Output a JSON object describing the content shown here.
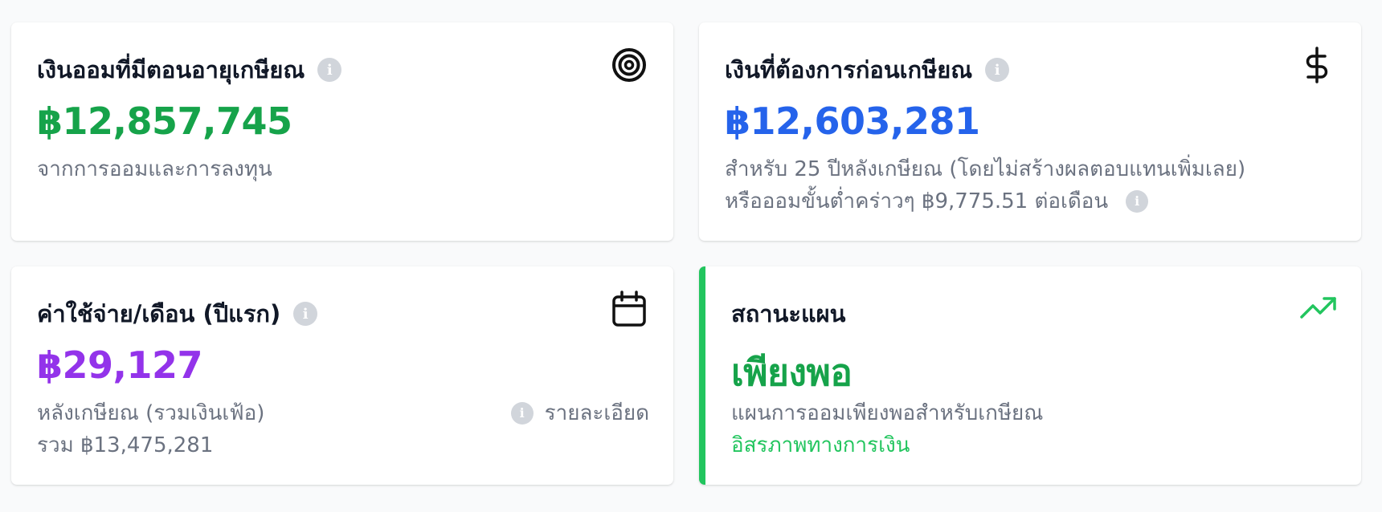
{
  "cards": {
    "savings_at_retirement": {
      "title": "เงินออมที่มีตอนอายุเกษียณ",
      "value": "฿12,857,745",
      "subtitle": "จากการออมและการลงทุน",
      "icon": "target-icon",
      "value_color": "#16a34a"
    },
    "money_needed": {
      "title": "เงินที่ต้องการก่อนเกษียณ",
      "value": "฿12,603,281",
      "subtitle": "สำหรับ 25 ปีหลังเกษียณ (โดยไม่สร้างผลตอบแทนเพิ่มเลย)",
      "subtitle2": "หรือออมขั้นต่ำคร่าวๆ ฿9,775.51 ต่อเดือน",
      "icon": "dollar-icon",
      "value_color": "#2563eb"
    },
    "monthly_expense": {
      "title": "ค่าใช้จ่าย/เดือน (ปีแรก)",
      "value": "฿29,127",
      "subtitle": "หลังเกษียณ (รวมเงินเฟ้อ)",
      "subtitle2": "รวม ฿13,475,281",
      "details_label": "รายละเอียด",
      "icon": "calendar-icon",
      "value_color": "#9333ea"
    },
    "plan_status": {
      "title": "สถานะแผน",
      "value": "เพียงพอ",
      "subtitle": "แผนการออมเพียงพอสำหรับเกษียณ",
      "subtitle2": "อิสรภาพทางการเงิน",
      "icon": "trending-up-icon",
      "accent_color": "#22c55e"
    }
  }
}
